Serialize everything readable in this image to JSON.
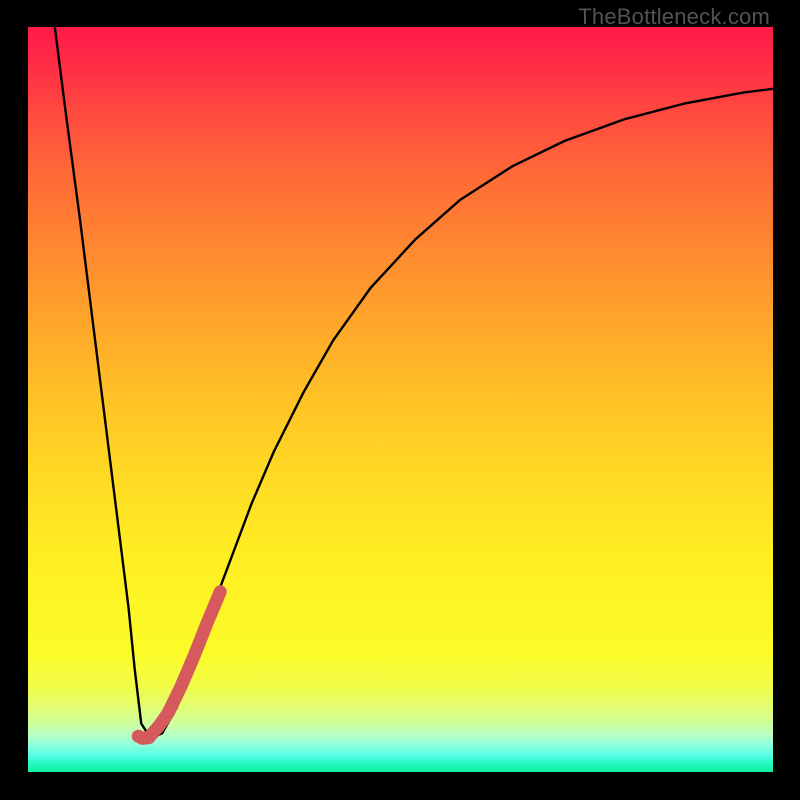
{
  "watermark": "TheBottleneck.com",
  "colors": {
    "frame": "#000000",
    "curve": "#000000",
    "highlight": "#d65a5c"
  },
  "chart_data": {
    "type": "line",
    "title": "",
    "xlabel": "",
    "ylabel": "",
    "xlim": [
      0,
      100
    ],
    "ylim": [
      0,
      100
    ],
    "grid": false,
    "series": [
      {
        "name": "bottleneck-curve",
        "x": [
          3.6,
          5,
          7,
          9,
          11,
          12.5,
          13.5,
          14.3,
          15.2,
          16.5,
          18,
          20,
          22,
          24,
          27,
          30,
          33,
          37,
          41,
          46,
          52,
          58,
          65,
          72,
          80,
          88,
          96,
          100
        ],
        "y": [
          100,
          89,
          74,
          58,
          42,
          30,
          22,
          14,
          6.5,
          4.5,
          5.2,
          8.7,
          14,
          20,
          28,
          36,
          43,
          51,
          58,
          65,
          71.5,
          76.8,
          81.3,
          84.7,
          87.6,
          89.7,
          91.2,
          91.7
        ]
      },
      {
        "name": "highlighted-segment",
        "x": [
          14.8,
          15.4,
          16.2,
          17.6,
          18.8,
          20.5,
          22.3,
          24.0,
          25.8
        ],
        "y": [
          4.8,
          4.5,
          4.6,
          6.2,
          7.9,
          11.4,
          15.6,
          19.9,
          24.2
        ]
      }
    ],
    "annotations": []
  }
}
